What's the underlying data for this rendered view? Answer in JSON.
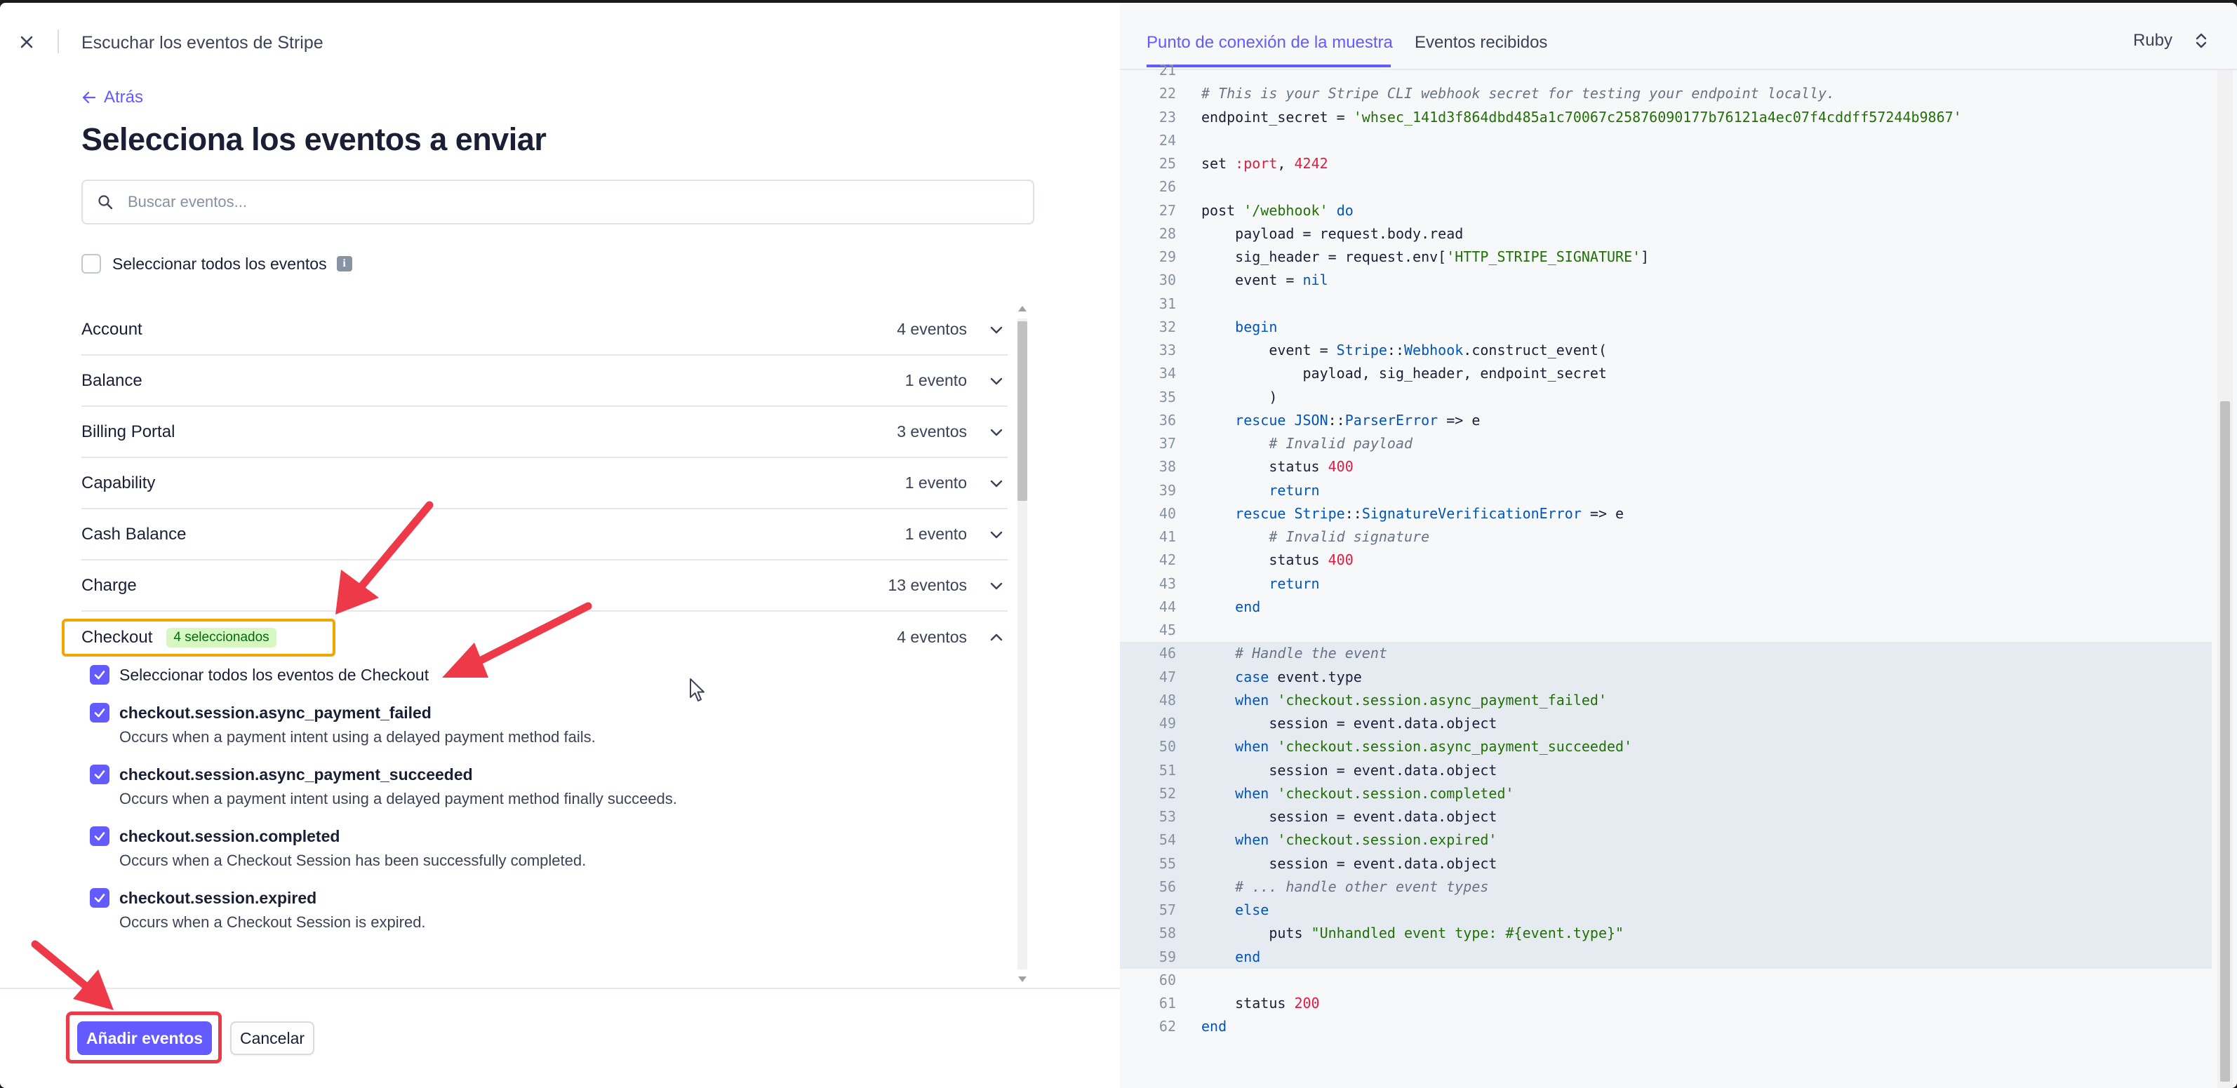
{
  "header": {
    "title": "Escuchar los eventos de Stripe"
  },
  "form": {
    "back_label": "Atrás",
    "title": "Selecciona los eventos a enviar",
    "search_placeholder": "Buscar eventos...",
    "select_all_label": "Seleccionar todos los eventos"
  },
  "categories": [
    {
      "name": "Account",
      "count": "4 eventos"
    },
    {
      "name": "Balance",
      "count": "1 evento"
    },
    {
      "name": "Billing Portal",
      "count": "3 eventos"
    },
    {
      "name": "Capability",
      "count": "1 evento"
    },
    {
      "name": "Cash Balance",
      "count": "1 evento"
    },
    {
      "name": "Charge",
      "count": "13 eventos"
    },
    {
      "name": "Checkout",
      "count": "4 eventos",
      "badge": "4 seleccionados"
    }
  ],
  "checkout": {
    "select_all_label": "Seleccionar todos los eventos de Checkout",
    "events": [
      {
        "name": "checkout.session.async_payment_failed",
        "desc": "Occurs when a payment intent using a delayed payment method fails."
      },
      {
        "name": "checkout.session.async_payment_succeeded",
        "desc": "Occurs when a payment intent using a delayed payment method finally succeeds."
      },
      {
        "name": "checkout.session.completed",
        "desc": "Occurs when a Checkout Session has been successfully completed."
      },
      {
        "name": "checkout.session.expired",
        "desc": "Occurs when a Checkout Session is expired."
      }
    ]
  },
  "footer": {
    "add_label": "Añadir eventos",
    "cancel_label": "Cancelar"
  },
  "code_panel": {
    "tab_active": "Punto de conexión de la muestra",
    "tab_inactive": "Eventos recibidos",
    "language": "Ruby",
    "line_numbers": [
      "21",
      "22",
      "23",
      "24",
      "25",
      "26",
      "27",
      "28",
      "29",
      "30",
      "31",
      "32",
      "33",
      "34",
      "35",
      "36",
      "37",
      "38",
      "39",
      "40",
      "41",
      "42",
      "43",
      "44",
      "45",
      "46",
      "47",
      "48",
      "49",
      "50",
      "51",
      "52",
      "53",
      "54",
      "55",
      "56",
      "57",
      "58",
      "59",
      "60",
      "61",
      "62"
    ],
    "lines": [
      "",
      "# This is your Stripe CLI webhook secret for testing your endpoint locally.",
      "endpoint_secret = 'whsec_141d3f864dbd485a1c70067c25876090177b76121a4ec07f4cddff57244b9867'",
      "",
      "set :port, 4242",
      "",
      "post '/webhook' do",
      "    payload = request.body.read",
      "    sig_header = request.env['HTTP_STRIPE_SIGNATURE']",
      "    event = nil",
      "",
      "    begin",
      "        event = Stripe::Webhook.construct_event(",
      "            payload, sig_header, endpoint_secret",
      "        )",
      "    rescue JSON::ParserError => e",
      "        # Invalid payload",
      "        status 400",
      "        return",
      "    rescue Stripe::SignatureVerificationError => e",
      "        # Invalid signature",
      "        status 400",
      "        return",
      "    end",
      "",
      "    # Handle the event",
      "    case event.type",
      "    when 'checkout.session.async_payment_failed'",
      "        session = event.data.object",
      "    when 'checkout.session.async_payment_succeeded'",
      "        session = event.data.object",
      "    when 'checkout.session.completed'",
      "        session = event.data.object",
      "    when 'checkout.session.expired'",
      "        session = event.data.object",
      "    # ... handle other event types",
      "    else",
      "        puts \"Unhandled event type: #{event.type}\"",
      "    end",
      "",
      "    status 200",
      "end"
    ],
    "highlighted_lines": [
      "46",
      "47",
      "48",
      "49",
      "50",
      "51",
      "52",
      "53",
      "54",
      "55",
      "56",
      "57",
      "58",
      "59"
    ]
  },
  "colors": {
    "accent": "#635bff",
    "annotation_red": "#ee3a48",
    "annotation_orange": "#f0a800",
    "badge_bg": "#d7f7c2",
    "badge_text": "#05690d"
  }
}
